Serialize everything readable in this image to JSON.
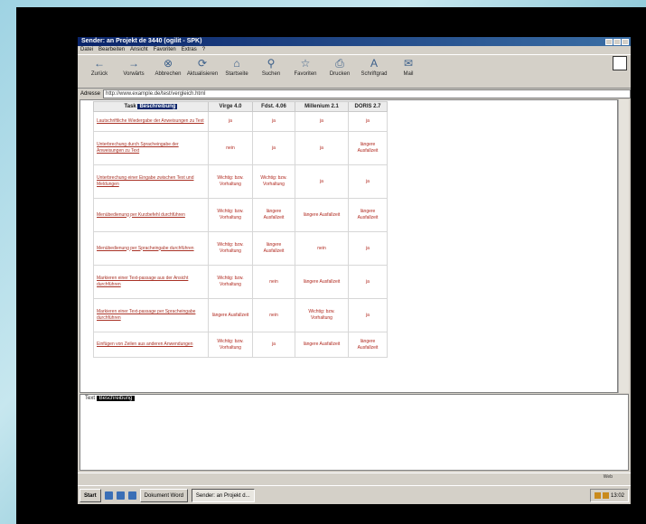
{
  "window": {
    "title": "Sender: an Projekt de 3440 (ogilit - SPK)"
  },
  "menu": [
    "Datei",
    "Bearbeiten",
    "Ansicht",
    "Favoriten",
    "Extras",
    "?"
  ],
  "toolbar": [
    {
      "label": "Zurück",
      "icon": "back-arrow-icon",
      "glyph": "←"
    },
    {
      "label": "Vorwärts",
      "icon": "forward-arrow-icon",
      "glyph": "→"
    },
    {
      "label": "Abbrechen",
      "icon": "stop-icon",
      "glyph": "⊗"
    },
    {
      "label": "Aktualisieren",
      "icon": "refresh-icon",
      "glyph": "⟳"
    },
    {
      "label": "Startseite",
      "icon": "home-icon",
      "glyph": "⌂"
    },
    {
      "label": "Suchen",
      "icon": "search-icon",
      "glyph": "⚲"
    },
    {
      "label": "Favoriten",
      "icon": "favorites-icon",
      "glyph": "☆"
    },
    {
      "label": "Drucken",
      "icon": "print-icon",
      "glyph": "⎙"
    },
    {
      "label": "Schriftgrad",
      "icon": "font-size-icon",
      "glyph": "A"
    },
    {
      "label": "Mail",
      "icon": "mail-icon",
      "glyph": "✉"
    }
  ],
  "address": {
    "label": "Adresse",
    "value": "http://www.example.de/test/vergleich.html"
  },
  "table": {
    "headers": [
      "Task",
      "Virge 4.0",
      "Fdst. 4.06",
      "Millenium 2.1",
      "DORIS 2.7"
    ],
    "task_highlight": "Beschreibung",
    "rows": [
      {
        "task": "Lautschriftliche Wiedergabe der Anweisungen zu Text",
        "cells": [
          "ja",
          "ja",
          "ja",
          "ja"
        ]
      },
      {
        "task": "Unterbrechung durch Spracheingabe der Anweisungen zu Text",
        "cells": [
          "nein",
          "ja",
          "ja",
          "längere Ausfallzeit"
        ]
      },
      {
        "task": "Unterbrechung einer Eingabe zwischen Text und Meldungen",
        "cells": [
          "Wichtig: bzw. Vorhaltung",
          "Wichtig: bzw. Vorhaltung",
          "ja",
          "ja"
        ]
      },
      {
        "task": "Menübedienung per Kurzbefehl durchführen",
        "cells": [
          "Wichtig: bzw. Vorhaltung",
          "längere Ausfallzeit",
          "längere Ausfallzeit",
          "längere Ausfallzeit"
        ]
      },
      {
        "task": "Menübedienung per Spracheingabe durchführen",
        "cells": [
          "Wichtig: bzw. Vorhaltung",
          "längere Ausfallzeit",
          "nein",
          "ja"
        ]
      },
      {
        "task": "Markieren einer Text-passage aus der Ansicht durchführen",
        "cells": [
          "Wichtig: bzw. Vorhaltung",
          "nein",
          "längere Ausfallzeit",
          "ja"
        ]
      },
      {
        "task": "Markieren einer Text-passage per Spracheingabe durchführen",
        "cells": [
          "längere Ausfallzeit",
          "nein",
          "Wichtig: bzw. Vorhaltung",
          "ja"
        ]
      },
      {
        "task": "Einfügen von Zeilen aus anderen Anwendungen",
        "cells": [
          "Wichtig: bzw. Vorhaltung",
          "ja",
          "längere Ausfallzeit",
          "längere Ausfallzeit"
        ]
      }
    ]
  },
  "textpane": {
    "label": "Text",
    "highlight": "Beschreibung"
  },
  "statusbar": {
    "zone": "Web"
  },
  "taskbar": {
    "start": "Start",
    "tasks": [
      {
        "label": "Dokument Word",
        "active": false
      },
      {
        "label": "Sender: an Projekt d...",
        "active": true
      }
    ],
    "clock": "13:02"
  }
}
